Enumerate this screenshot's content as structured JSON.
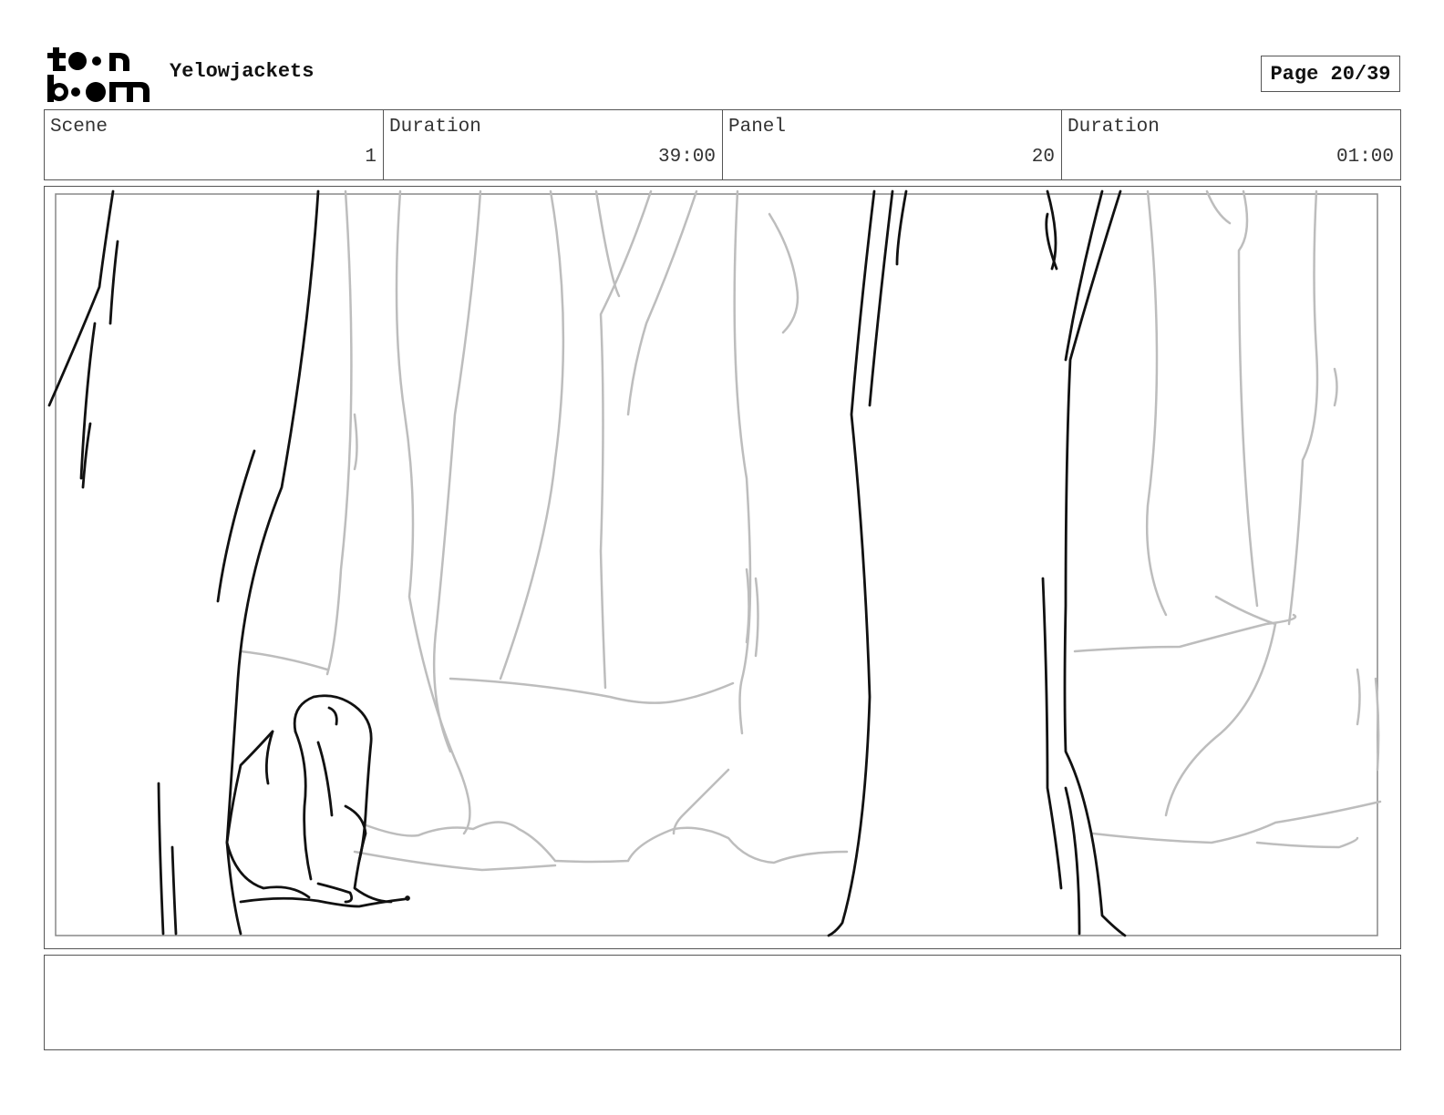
{
  "header": {
    "logo_text": "toon boom",
    "project_title": "Yelowjackets",
    "page_label": "Page 20/39"
  },
  "info": {
    "scene_label": "Scene",
    "scene_value": "1",
    "scene_duration_label": "Duration",
    "scene_duration_value": "39:00",
    "panel_label": "Panel",
    "panel_value": "20",
    "panel_duration_label": "Duration",
    "panel_duration_value": "01:00"
  },
  "panel": {
    "description": "",
    "colors": {
      "ink": "#111111",
      "background_pencil": "#b8b8b8"
    }
  },
  "notes": {
    "text": ""
  }
}
